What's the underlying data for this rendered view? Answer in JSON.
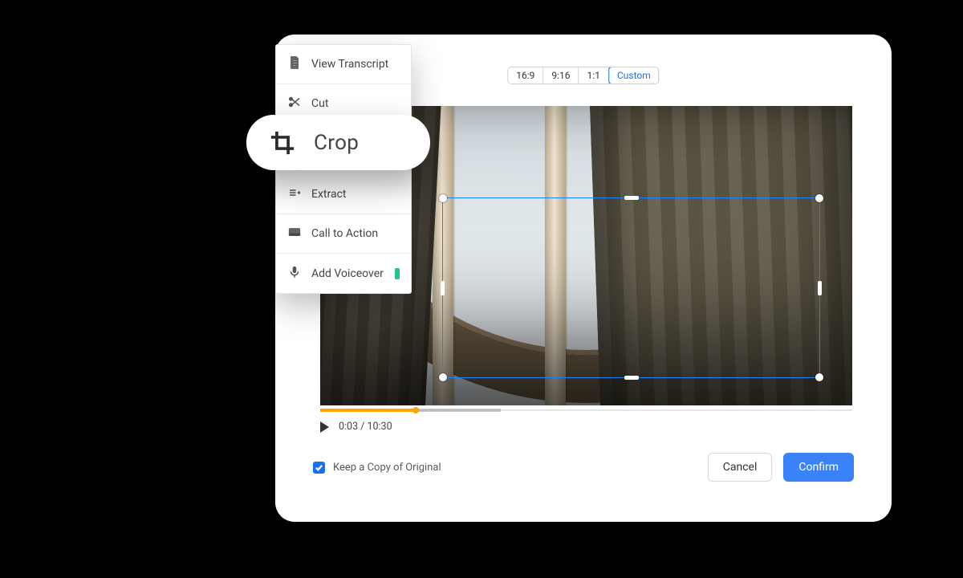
{
  "aspect": {
    "options": [
      "16:9",
      "9:16",
      "1:1",
      "Custom"
    ],
    "active_index": 3
  },
  "menu": {
    "items": [
      {
        "id": "transcript",
        "label": "View Transcript",
        "icon": "document-icon"
      },
      {
        "id": "cut",
        "label": "Cut",
        "icon": "scissors-icon"
      },
      {
        "id": "crop",
        "label": "Crop",
        "icon": "crop-icon",
        "highlighted": true
      },
      {
        "id": "extract",
        "label": "Extract",
        "icon": "extract-icon"
      },
      {
        "id": "cta",
        "label": "Call to Action",
        "icon": "cta-icon"
      },
      {
        "id": "voiceover",
        "label": "Add Voiceover",
        "icon": "mic-icon",
        "new": true
      }
    ]
  },
  "playback": {
    "current": "0:03",
    "duration": "10:30",
    "display": "0:03 / 10:30"
  },
  "footer": {
    "keep_copy_label": "Keep a Copy of Original",
    "keep_copy_checked": true,
    "cancel_label": "Cancel",
    "confirm_label": "Confirm"
  },
  "crop_pill_label": "Crop"
}
